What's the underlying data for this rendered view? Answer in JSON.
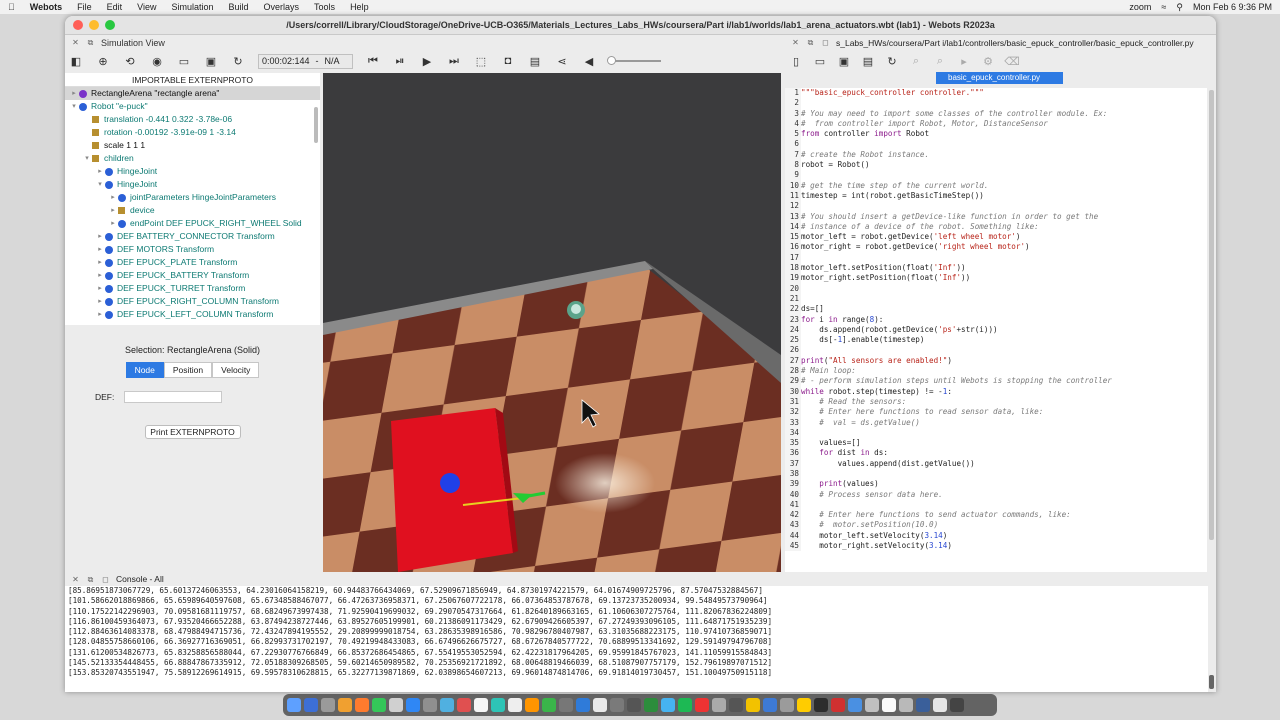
{
  "menubar": {
    "app": "Webots",
    "items": [
      "File",
      "Edit",
      "View",
      "Simulation",
      "Build",
      "Overlays",
      "Tools",
      "Help"
    ],
    "zoom": "zoom",
    "datetime": "Mon Feb 6  9:36 PM"
  },
  "window": {
    "title": "/Users/correll/Library/CloudStorage/OneDrive-UCB-O365/Materials_Lectures_Labs_HWs/coursera/Part i/lab1/worlds/lab1_arena_actuators.wbt (lab1) - Webots R2023a"
  },
  "simulation": {
    "panel_title": "Simulation View",
    "time": "0:00:02:144",
    "speed": "N/A",
    "tree_header": "IMPORTABLE EXTERNPROTO",
    "tree": [
      {
        "label": "RectangleArena \"rectangle arena\"",
        "kind": "dot",
        "color": "#7a33c9",
        "indent": 0,
        "arrow": "▸",
        "cls": "black",
        "selected": true
      },
      {
        "label": "Robot \"e-puck\"",
        "kind": "dot",
        "color": "#2b5fd6",
        "indent": 0,
        "arrow": "▾",
        "cls": "teal"
      },
      {
        "label": "translation -0.441 0.322 -3.78e-06",
        "kind": "sq",
        "indent": 1,
        "arrow": "",
        "cls": "teal"
      },
      {
        "label": "rotation -0.00192 -3.91e-09 1 -3.14",
        "kind": "sq",
        "indent": 1,
        "arrow": "",
        "cls": "teal"
      },
      {
        "label": "scale 1 1 1",
        "kind": "sq",
        "indent": 1,
        "arrow": "",
        "cls": "black"
      },
      {
        "label": "children",
        "kind": "sq",
        "indent": 1,
        "arrow": "▾",
        "cls": "teal"
      },
      {
        "label": "HingeJoint",
        "kind": "dot",
        "color": "#2b5fd6",
        "indent": 2,
        "arrow": "▸",
        "cls": "teal"
      },
      {
        "label": "HingeJoint",
        "kind": "dot",
        "color": "#2b5fd6",
        "indent": 2,
        "arrow": "▾",
        "cls": "teal"
      },
      {
        "label": "jointParameters HingeJointParameters",
        "kind": "dot",
        "color": "#2b5fd6",
        "indent": 3,
        "arrow": "▸",
        "cls": "teal"
      },
      {
        "label": "device",
        "kind": "sq",
        "indent": 3,
        "arrow": "▸",
        "cls": "teal"
      },
      {
        "label": "endPoint DEF EPUCK_RIGHT_WHEEL Solid",
        "kind": "dot",
        "color": "#2b5fd6",
        "indent": 3,
        "arrow": "▸",
        "cls": "teal"
      },
      {
        "label": "DEF BATTERY_CONNECTOR Transform",
        "kind": "dot",
        "color": "#2b5fd6",
        "indent": 2,
        "arrow": "▸",
        "cls": "teal"
      },
      {
        "label": "DEF MOTORS Transform",
        "kind": "dot",
        "color": "#2b5fd6",
        "indent": 2,
        "arrow": "▸",
        "cls": "teal"
      },
      {
        "label": "DEF EPUCK_PLATE Transform",
        "kind": "dot",
        "color": "#2b5fd6",
        "indent": 2,
        "arrow": "▸",
        "cls": "teal"
      },
      {
        "label": "DEF EPUCK_BATTERY Transform",
        "kind": "dot",
        "color": "#2b5fd6",
        "indent": 2,
        "arrow": "▸",
        "cls": "teal"
      },
      {
        "label": "DEF EPUCK_TURRET Transform",
        "kind": "dot",
        "color": "#2b5fd6",
        "indent": 2,
        "arrow": "▸",
        "cls": "teal"
      },
      {
        "label": "DEF EPUCK_RIGHT_COLUMN Transform",
        "kind": "dot",
        "color": "#2b5fd6",
        "indent": 2,
        "arrow": "▸",
        "cls": "teal"
      },
      {
        "label": "DEF EPUCK_LEFT_COLUMN Transform",
        "kind": "dot",
        "color": "#2b5fd6",
        "indent": 2,
        "arrow": "▸",
        "cls": "teal"
      }
    ],
    "selection": "Selection: RectangleArena (Solid)",
    "tabs": [
      "Node",
      "Position",
      "Velocity"
    ],
    "def_label": "DEF:",
    "def_value": "",
    "print_button": "Print EXTERNPROTO"
  },
  "editor": {
    "path": "s_Labs_HWs/coursera/Part i/lab1/controllers/basic_epuck_controller/basic_epuck_controller.py",
    "tab": "basic_epuck_controller.py",
    "lines": [
      [
        [
          "st",
          "\"\"\"basic_epuck_controller controller.\"\"\""
        ]
      ],
      [
        [
          "",
          ""
        ]
      ],
      [
        [
          "cm",
          "# You may need to import some classes of the controller module. Ex:"
        ]
      ],
      [
        [
          "cm",
          "#  from controller import Robot, Motor, DistanceSensor"
        ]
      ],
      [
        [
          "kw",
          "from"
        ],
        [
          "",
          " controller "
        ],
        [
          "kw",
          "import"
        ],
        [
          "",
          " Robot"
        ]
      ],
      [
        [
          "",
          ""
        ]
      ],
      [
        [
          "cm",
          "# create the Robot instance."
        ]
      ],
      [
        [
          "",
          "robot = Robot()"
        ]
      ],
      [
        [
          "",
          ""
        ]
      ],
      [
        [
          "cm",
          "# get the time step of the current world."
        ]
      ],
      [
        [
          "",
          "timestep = int(robot.getBasicTimeStep())"
        ]
      ],
      [
        [
          "",
          ""
        ]
      ],
      [
        [
          "cm",
          "# You should insert a getDevice-like function in order to get the"
        ]
      ],
      [
        [
          "cm",
          "# instance of a device of the robot. Something like:"
        ]
      ],
      [
        [
          "",
          "motor_left = robot.getDevice("
        ],
        [
          "st",
          "'left wheel motor'"
        ],
        [
          "",
          ")"
        ]
      ],
      [
        [
          "",
          "motor_right = robot.getDevice("
        ],
        [
          "st",
          "'right wheel motor'"
        ],
        [
          "",
          ")"
        ]
      ],
      [
        [
          "",
          ""
        ]
      ],
      [
        [
          "",
          "motor_left.setPosition(float("
        ],
        [
          "st",
          "'Inf'"
        ],
        [
          "",
          "))"
        ]
      ],
      [
        [
          "",
          "motor_right.setPosition(float("
        ],
        [
          "st",
          "'Inf'"
        ],
        [
          "",
          "))"
        ]
      ],
      [
        [
          "",
          ""
        ]
      ],
      [
        [
          "",
          ""
        ]
      ],
      [
        [
          "",
          "ds=[]"
        ]
      ],
      [
        [
          "kw",
          "for"
        ],
        [
          "",
          " i "
        ],
        [
          "kw",
          "in"
        ],
        [
          "",
          " range("
        ],
        [
          "nm",
          "8"
        ],
        [
          "",
          "):"
        ]
      ],
      [
        [
          "",
          "    ds.append(robot.getDevice("
        ],
        [
          "st",
          "'ps'"
        ],
        [
          "",
          "+str(i)))"
        ]
      ],
      [
        [
          "",
          "    ds[-"
        ],
        [
          "nm",
          "1"
        ],
        [
          "",
          "].enable(timestep)"
        ]
      ],
      [
        [
          "",
          ""
        ]
      ],
      [
        [
          "kw",
          "print"
        ],
        [
          "",
          "("
        ],
        [
          "st",
          "\"All sensors are enabled!\""
        ],
        [
          "",
          ")"
        ]
      ],
      [
        [
          "cm",
          "# Main loop:"
        ]
      ],
      [
        [
          "cm",
          "# - perform simulation steps until Webots is stopping the controller"
        ]
      ],
      [
        [
          "kw",
          "while"
        ],
        [
          "",
          " robot.step(timestep) != -"
        ],
        [
          "nm",
          "1"
        ],
        [
          "",
          ":"
        ]
      ],
      [
        [
          "cm",
          "    # Read the sensors:"
        ]
      ],
      [
        [
          "cm",
          "    # Enter here functions to read sensor data, like:"
        ]
      ],
      [
        [
          "cm",
          "    #  val = ds.getValue()"
        ]
      ],
      [
        [
          "",
          ""
        ]
      ],
      [
        [
          "",
          "    values=[]"
        ]
      ],
      [
        [
          "",
          "    "
        ],
        [
          "kw",
          "for"
        ],
        [
          "",
          " dist "
        ],
        [
          "kw",
          "in"
        ],
        [
          "",
          " ds:"
        ]
      ],
      [
        [
          "",
          "        values.append(dist.getValue())"
        ]
      ],
      [
        [
          "",
          ""
        ]
      ],
      [
        [
          "",
          "    "
        ],
        [
          "kw",
          "print"
        ],
        [
          "",
          "(values)"
        ]
      ],
      [
        [
          "cm",
          "    # Process sensor data here."
        ]
      ],
      [
        [
          "",
          ""
        ]
      ],
      [
        [
          "cm",
          "    # Enter here functions to send actuator commands, like:"
        ]
      ],
      [
        [
          "cm",
          "    #  motor.setPosition(10.0)"
        ]
      ],
      [
        [
          "",
          "    motor_left.setVelocity("
        ],
        [
          "nm",
          "3.14"
        ],
        [
          "",
          ")"
        ]
      ],
      [
        [
          "",
          "    motor_right.setVelocity("
        ],
        [
          "nm",
          "3.14"
        ],
        [
          "",
          ")"
        ]
      ]
    ]
  },
  "console": {
    "title": "Console - All",
    "lines": [
      "[85.86951873067729, 65.60137246063553, 64.23016064158219, 60.94483766434069, 67.52909671856949, 64.87301974221579, 64.01674909725796, 87.57047532884567]",
      "[101.58662018869866, 65.65989640597608, 65.67348588467077, 66.47263736958371, 67.25067607722178, 66.07364853787678, 69.13723735200934, 99.54849573790964]",
      "[110.17522142296903, 70.09581681119757, 68.68249673997438, 71.92590419699032, 69.29070547317664, 61.82640189663165, 61.10606307275764, 111.82067836224809]",
      "[116.86100459364073, 67.93520466652288, 63.87494238727446, 63.89527605199901, 60.21386091173429, 62.67909426605397, 67.27249393096105, 111.64871751935239]",
      "[112.88463614083378, 68.47988494715736, 72.43247894195552, 29.20899999018754, 63.28635398916586, 70.98296780407987, 63.31035688223175, 110.97410736859071]",
      "[128.04855758660106, 66.36927716369051, 66.82993731702197, 70.49219948433083, 66.67496626675727, 68.67267840577722, 70.68899513341692, 129.59149794796708]",
      "[131.61200534826773, 65.83258856588044, 67.22930776766849, 66.85372686454865, 67.55419553052594, 62.42231817964205, 69.95991845767023, 141.11059915584843]",
      "[145.52133354448455, 66.88847867335912, 72.05188309268505, 59.60214650989582, 70.25356921721892, 68.00648819466039, 68.51087907757179, 152.79619897071512]",
      "[153.85320743551947, 75.58912269614915, 69.59578310628815, 65.32277139871869, 62.03898654607213, 69.96014874814706, 69.91814019730457, 151.10049750915118]"
    ]
  },
  "colors": {
    "accent": "#2d7ae3",
    "box": "#e0101f",
    "floor_dark": "#6b2e22",
    "floor_light": "#c98d66"
  },
  "dock_colors": [
    "#5ea0ff",
    "#3d6fd6",
    "#9a9a9a",
    "#f0a030",
    "#ff7b2e",
    "#34c759",
    "#d0d0d0",
    "#2f87f5",
    "#8f8f8f",
    "#50b0e0",
    "#e05050",
    "#f5f5f5",
    "#2ec4b6",
    "#eee",
    "#ff9500",
    "#3ab54a",
    "#777",
    "#2f7bd9",
    "#e8e8e8",
    "#7a7a7a",
    "#555",
    "#2c8d3c",
    "#46b3f0",
    "#1db954",
    "#e33",
    "#aaa",
    "#555",
    "#f2c200",
    "#3d7ad6",
    "#9b9b9b",
    "#ffcc00",
    "#2d2d2d",
    "#d03030",
    "#4a90e2",
    "#c0c0c0",
    "#fafafa",
    "#b9b9b9",
    "#3a5f9a",
    "#e6e6e6",
    "#444"
  ]
}
